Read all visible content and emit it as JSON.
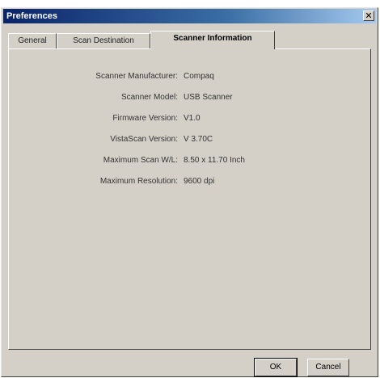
{
  "window": {
    "title": "Preferences",
    "close_glyph": "✕"
  },
  "tabs": [
    {
      "label": "General",
      "active": false
    },
    {
      "label": "Scan Destination",
      "active": false
    },
    {
      "label": "Scanner Information",
      "active": true
    }
  ],
  "info": {
    "rows": [
      {
        "label": "Scanner Manufacturer:",
        "value": "Compaq"
      },
      {
        "label": "Scanner Model:",
        "value": "USB Scanner"
      },
      {
        "label": "Firmware Version:",
        "value": "V1.0"
      },
      {
        "label": "VistaScan Version:",
        "value": "V 3.70C"
      },
      {
        "label": "Maximum Scan W/L:",
        "value": "8.50 x 11.70 Inch"
      },
      {
        "label": "Maximum Resolution:",
        "value": "9600 dpi"
      }
    ]
  },
  "buttons": {
    "ok_label": "OK",
    "cancel_label": "Cancel"
  },
  "colors": {
    "face": "#d4d0c8",
    "title_start": "#0a246a",
    "title_end": "#a6caf0"
  }
}
